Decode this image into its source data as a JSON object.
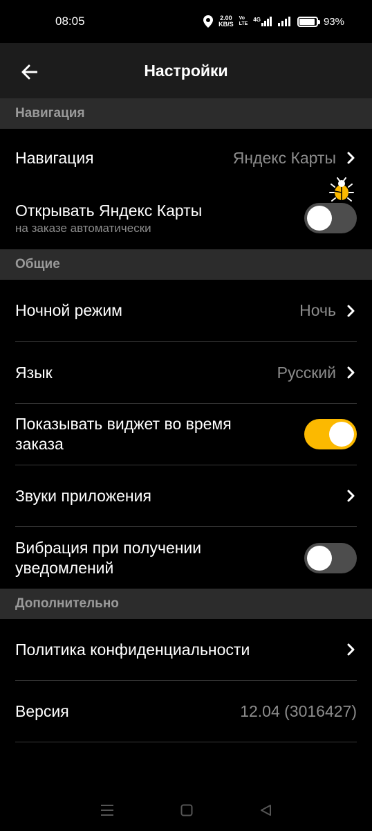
{
  "status": {
    "time": "08:05",
    "speed_value": "2.00",
    "speed_unit": "KB/S",
    "volte_top": "Vo",
    "volte_bottom": "LTE",
    "network": "4G",
    "battery": "93%"
  },
  "header": {
    "title": "Настройки"
  },
  "sections": {
    "navigation": {
      "title": "Навигация",
      "nav_label": "Навигация",
      "nav_value": "Яндекс Карты",
      "open_maps_label": "Открывать Яндекс Карты",
      "open_maps_sub": "на заказе автоматически",
      "open_maps_on": false
    },
    "general": {
      "title": "Общие",
      "night_label": "Ночной режим",
      "night_value": "Ночь",
      "lang_label": "Язык",
      "lang_value": "Русский",
      "widget_label_1": "Показывать виджет во время",
      "widget_label_2": "заказа",
      "widget_on": true,
      "sounds_label": "Звуки приложения",
      "vibration_label_1": "Вибрация при получении",
      "vibration_label_2": "уведомлений",
      "vibration_on": false
    },
    "extra": {
      "title": "Дополнительно",
      "privacy_label": "Политика конфиденциальности",
      "version_label": "Версия",
      "version_value": "12.04 (3016427)"
    }
  },
  "colors": {
    "accent": "#fcb900",
    "background": "#000000",
    "section": "#2c2c2c"
  },
  "icons": [
    "back-arrow-icon",
    "chevron-right-icon",
    "bug-icon",
    "menu-icon",
    "home-icon",
    "back-triangle-icon"
  ]
}
